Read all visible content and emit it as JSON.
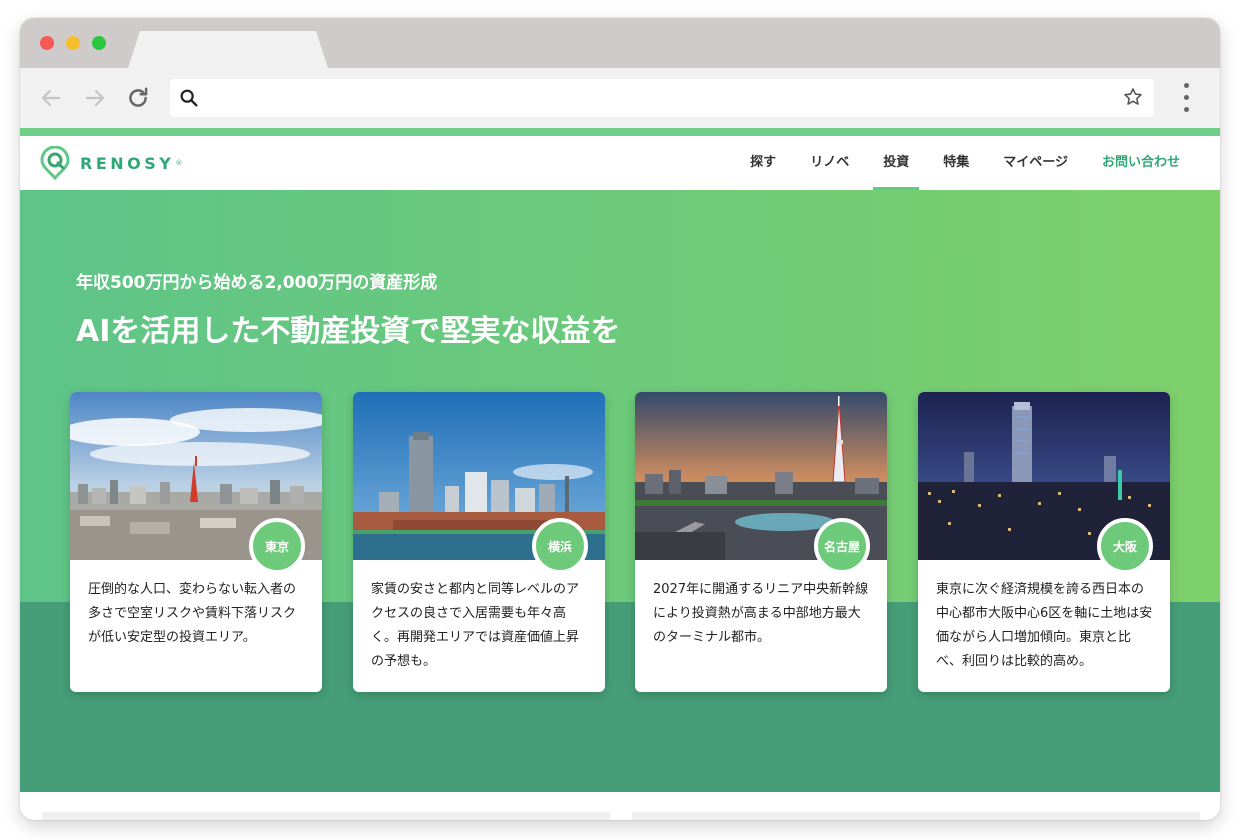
{
  "browser": {
    "address_value": "",
    "address_placeholder": ""
  },
  "site": {
    "logo_text": "RENOSY",
    "logo_reg": "®",
    "nav": [
      {
        "label": "探す"
      },
      {
        "label": "リノベ"
      },
      {
        "label": "投資",
        "active": true
      },
      {
        "label": "特集"
      },
      {
        "label": "マイページ"
      },
      {
        "label": "お問い合わせ",
        "accent": true
      }
    ],
    "accent_color": "#2fa776"
  },
  "hero": {
    "subtitle": "年収500万円から始める2,000万円の資産形成",
    "headline": "AIを活用した不動産投資で堅実な収益を"
  },
  "cards": [
    {
      "city": "東京",
      "description": "圧倒的な人口、変わらない転入者の多さで空室リスクや賃料下落リスクが低い安定型の投資エリア。",
      "image": "tokyo-skyline"
    },
    {
      "city": "横浜",
      "description": "家賃の安さと都内と同等レベルのアクセスの良さで入居需要も年々高く。再開発エリアでは資産価値上昇の予想も。",
      "image": "yokohama-skyline"
    },
    {
      "city": "名古屋",
      "description": "2027年に開通するリニア中央新幹線により投資熱が高まる中部地方最大のターミナル都市。",
      "image": "nagoya-skyline"
    },
    {
      "city": "大阪",
      "description": "東京に次ぐ経済規模を誇る西日本の中心都市大阪中心6区を軸に土地は安価ながら人口増加傾向。東京と比べ、利回りは比較的高め。",
      "image": "osaka-skyline"
    }
  ]
}
